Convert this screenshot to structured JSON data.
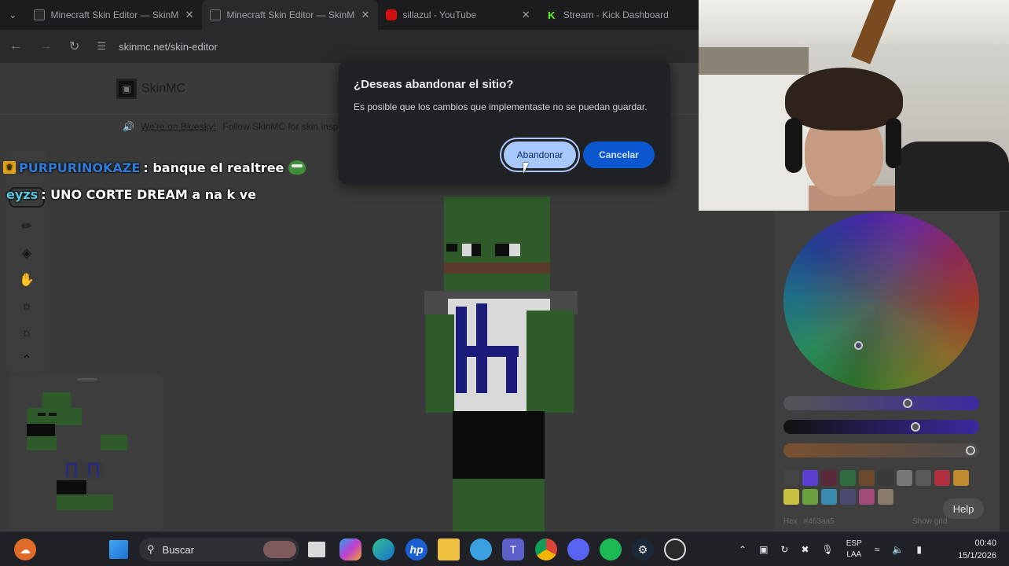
{
  "browser": {
    "tabs": [
      {
        "title": "Minecraft Skin Editor — SkinMC",
        "favicon_color": "#2a2a2a"
      },
      {
        "title": "Minecraft Skin Editor — SkinMC",
        "favicon_color": "#2a2a2a"
      },
      {
        "title": "sillazul - YouTube",
        "favicon_color": "#d01010"
      },
      {
        "title": "Stream - Kick Dashboard",
        "favicon_color": "#53fc18"
      }
    ],
    "url": "skinmc.net/skin-editor"
  },
  "site": {
    "brand": "SkinMC",
    "banner_link": "We're on Bluesky!",
    "banner_text": "Follow SkinMC for skin inspi"
  },
  "tools": [
    "select-icon",
    "eyedropper-icon",
    "bucket-icon",
    "hand-icon",
    "brightness-icon",
    "darken-icon",
    "more-icon"
  ],
  "color_panel": {
    "hex_label": "Hex",
    "hex_value": "#463aa5",
    "show_grid_label": "Show grid",
    "swatches": [
      "#444444",
      "#5a3fd0",
      "#5a2a3a",
      "#2f6f3f",
      "#6a4a2a",
      "#3a3a3a",
      "#777777",
      "#5a5a5a",
      "#b03040",
      "#c08a30",
      "#c8c040",
      "#6aa040",
      "#3a8ab0",
      "#4a4a70",
      "#a04a7a",
      "#8a7a6a"
    ],
    "help_label": "Help"
  },
  "chat": {
    "messages": [
      {
        "user": "PURPURINOKAZE",
        "text": ": banque el realtree"
      },
      {
        "user": "eyzs",
        "text": ": UNO CORTE DREAM a na k ve"
      }
    ]
  },
  "dialog": {
    "title": "¿Deseas abandonar el sitio?",
    "message": "Es posible que los cambios que implementaste no se puedan guardar.",
    "leave_label": "Abandonar",
    "cancel_label": "Cancelar"
  },
  "taskbar": {
    "search_placeholder": "Buscar",
    "lang_top": "ESP",
    "lang_bottom": "LAA",
    "time": "00:40",
    "date": "15/1/2026"
  }
}
